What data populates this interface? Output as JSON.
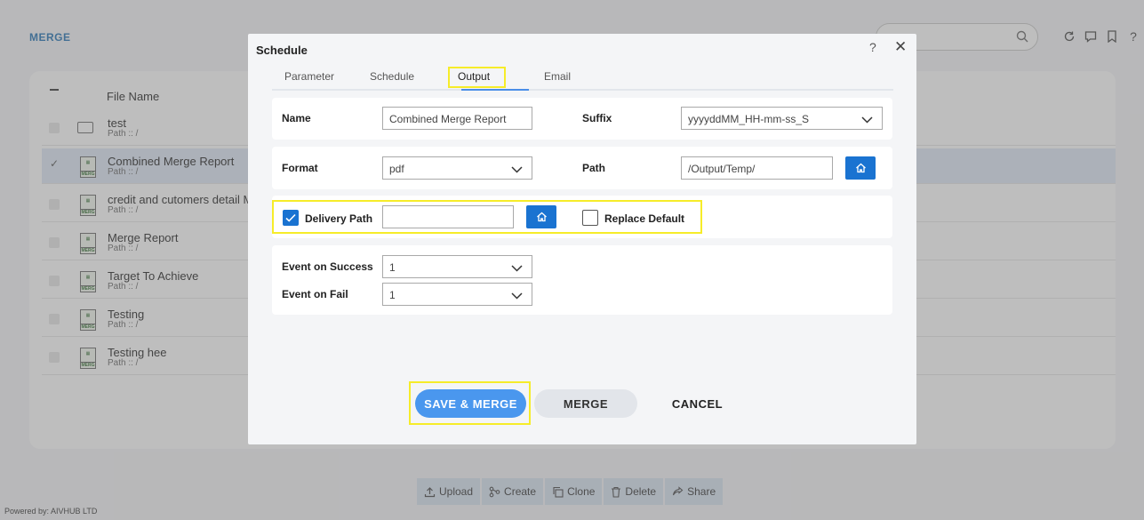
{
  "app": {
    "title": "MERGE",
    "search": {
      "placeholder": ""
    },
    "column_header": "File Name",
    "files": [
      {
        "name": "test",
        "path": "Path :: /",
        "type": "folder",
        "selected": false
      },
      {
        "name": "Combined Merge Report",
        "path": "Path :: /",
        "type": "merge",
        "selected": true
      },
      {
        "name": "credit and cutomers detail M",
        "path": "Path :: /",
        "type": "merge",
        "selected": false
      },
      {
        "name": "Merge Report",
        "path": "Path :: /",
        "type": "merge",
        "selected": false
      },
      {
        "name": "Target To Achieve",
        "path": "Path :: /",
        "type": "merge",
        "selected": false
      },
      {
        "name": "Testing",
        "path": "Path :: /",
        "type": "merge",
        "selected": false
      },
      {
        "name": "Testing hee",
        "path": "Path :: /",
        "type": "merge",
        "selected": false
      }
    ],
    "file_icon_text": "MERG",
    "toolbar": {
      "upload": "Upload",
      "create": "Create",
      "clone": "Clone",
      "delete": "Delete",
      "share": "Share"
    },
    "powered_by": "Powered by: AIVHUB LTD"
  },
  "dialog": {
    "title": "Schedule",
    "help": "?",
    "close": "✕",
    "tabs": {
      "parameter": "Parameter",
      "schedule": "Schedule",
      "output": "Output",
      "email": "Email"
    },
    "active_tab": "Output",
    "name_label": "Name",
    "name_value": "Combined Merge Report",
    "suffix_label": "Suffix",
    "suffix_value": "yyyyddMM_HH-mm-ss_S",
    "format_label": "Format",
    "format_value": "pdf",
    "path_label": "Path",
    "path_value": "/Output/Temp/",
    "delivery_path_label": "Delivery Path",
    "delivery_path_checked": true,
    "delivery_path_value": "",
    "replace_default_label": "Replace Default",
    "replace_default_checked": false,
    "event_success_label": "Event on Success",
    "event_success_value": "1",
    "event_fail_label": "Event on Fail",
    "event_fail_value": "1",
    "save_merge": "SAVE & MERGE",
    "merge": "MERGE",
    "cancel": "CANCEL"
  },
  "colors": {
    "accent": "#1a73d1",
    "primary_button": "#4a97ee",
    "highlight": "#f6ec29"
  }
}
